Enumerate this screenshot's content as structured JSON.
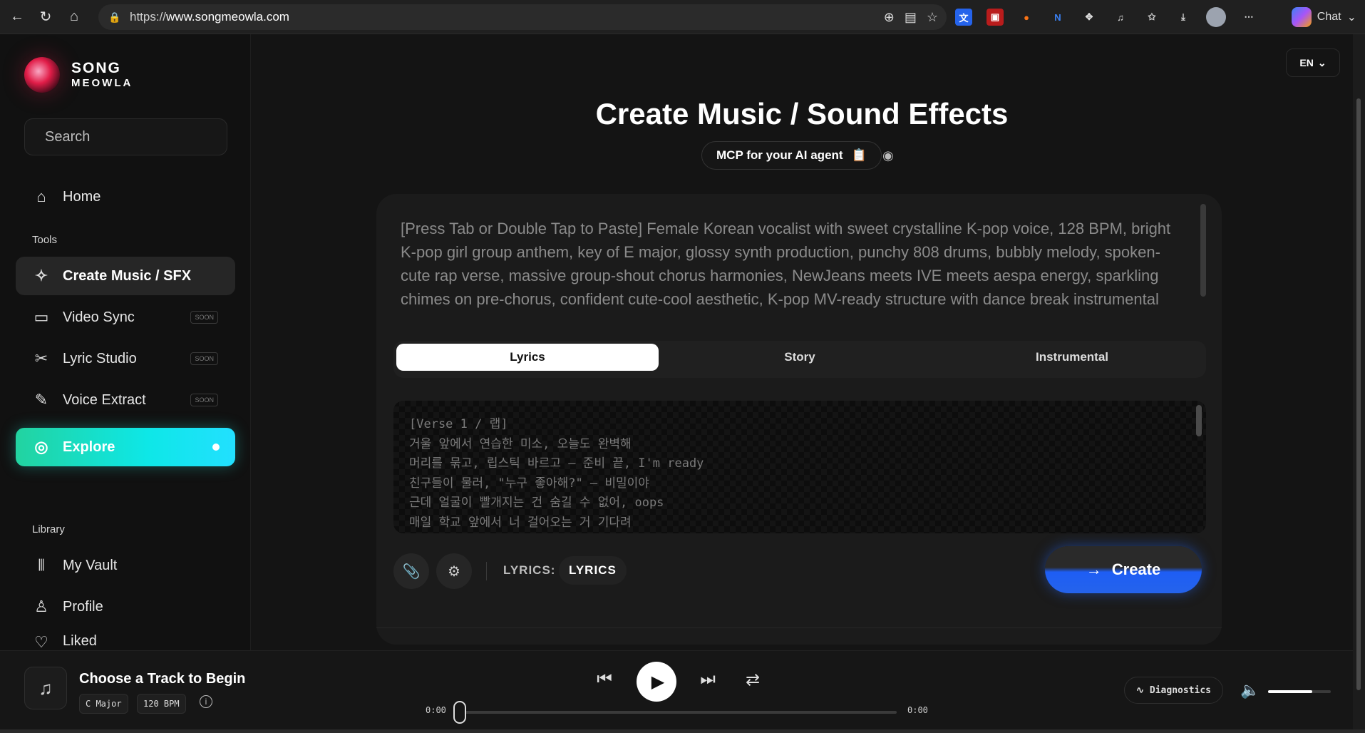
{
  "browser": {
    "url_proto": "https://",
    "url_host": "www.songmeowla.com",
    "chat_label": "Chat"
  },
  "sidebar": {
    "logo_line1": "SONG",
    "logo_line2": "MEOWLA",
    "search_placeholder": "Search",
    "home": "Home",
    "tools_label": "Tools",
    "items": [
      {
        "label": "Create Music / SFX",
        "icon": "sparkles-icon",
        "soon": ""
      },
      {
        "label": "Video Sync",
        "icon": "video-icon",
        "soon": "SOON"
      },
      {
        "label": "Lyric Studio",
        "icon": "scissors-icon",
        "soon": "SOON"
      },
      {
        "label": "Voice Extract",
        "icon": "pen-icon",
        "soon": "SOON"
      }
    ],
    "explore": "Explore",
    "library_label": "Library",
    "library": [
      {
        "label": "My Vault",
        "icon": "library-icon"
      },
      {
        "label": "Profile",
        "icon": "user-icon"
      },
      {
        "label": "Liked",
        "icon": "heart-icon"
      }
    ]
  },
  "main": {
    "lang": "EN",
    "title": "Create Music / Sound Effects",
    "mcp_label": "MCP for your AI agent",
    "prompt": "[Press Tab or Double Tap to Paste] Female Korean vocalist with sweet crystalline K-pop voice, 128 BPM, bright K-pop girl group anthem, key of E major, glossy synth production, punchy 808 drums, bubbly melody, spoken-cute rap verse, massive group-shout chorus harmonies, NewJeans meets IVE meets aespa energy, sparkling chimes on pre-chorus, confident cute-cool aesthetic, K-pop MV-ready structure with dance break instrumental section, entirely in Korean with signature English",
    "tabs": [
      "Lyrics",
      "Story",
      "Instrumental"
    ],
    "lyrics": [
      "[Verse 1 / 랩]",
      "거울 앞에서 연습한 미소, 오늘도 완벽해",
      "머리를 묶고, 립스틱 바르고 – 준비 끝, I'm ready",
      "친구들이 물러, \"누구 좋아해?\" – 비밀이야",
      "근데 얼굴이 빨개지는 건 숨길 수 없어, oops",
      "매일 학교 앞에서 너 걸어오는 거 기다려"
    ],
    "lyrics_label": "LYRICS:",
    "lyrics_chip": "LYRICS",
    "create_label": "Create"
  },
  "player": {
    "track_title": "Choose a Track to Begin",
    "key": "C Major",
    "bpm": "120 BPM",
    "time_current": "0:00",
    "time_total": "0:00",
    "diagnostics": "Diagnostics",
    "volume": 0.7
  }
}
